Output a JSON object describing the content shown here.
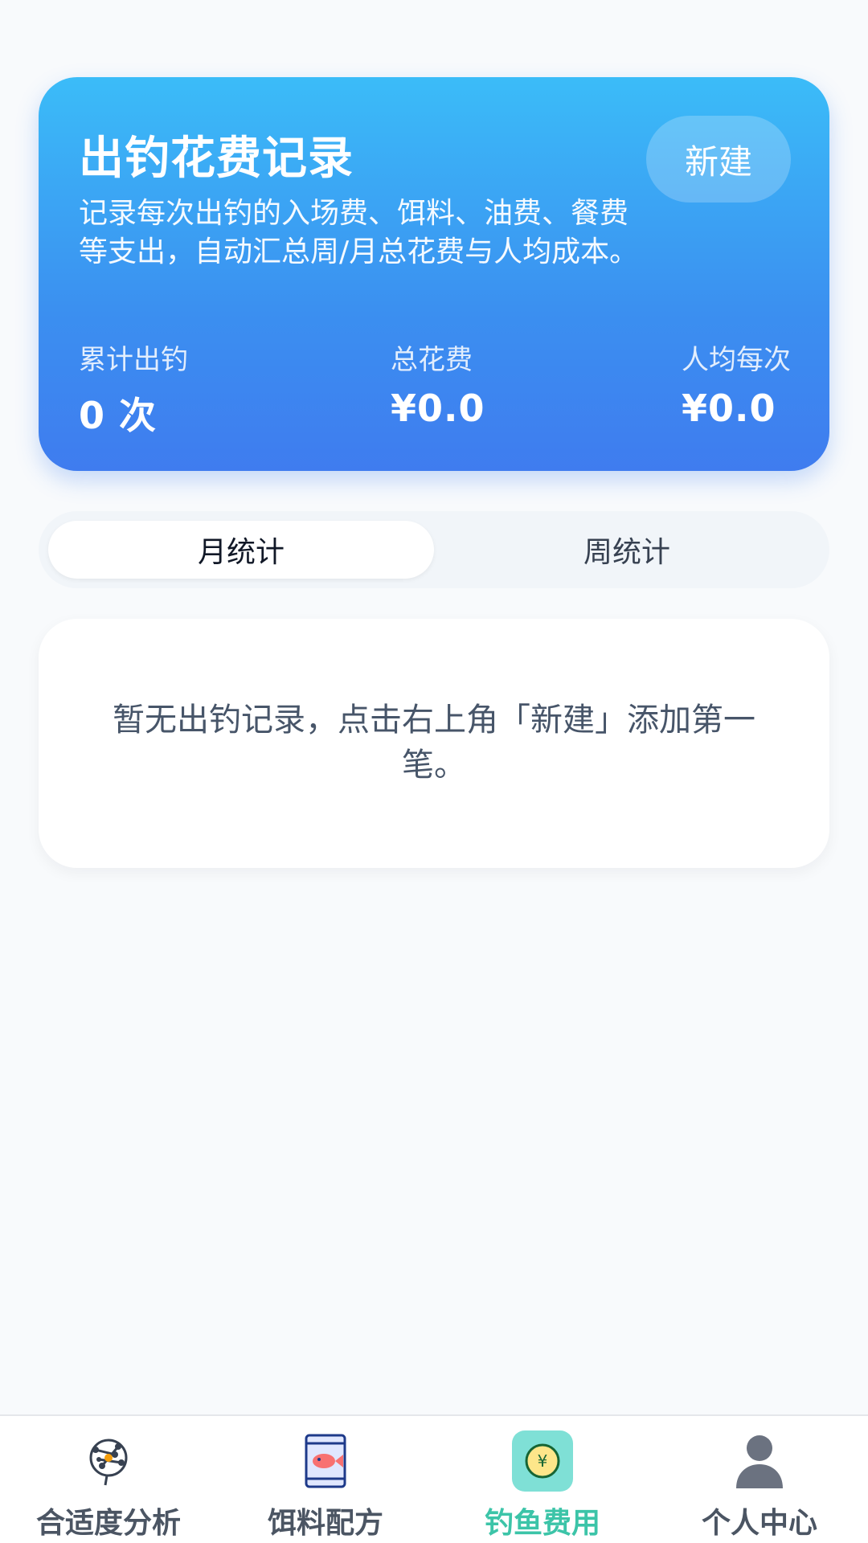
{
  "hero": {
    "title": "出钓花费记录",
    "description": "记录每次出钓的入场费、饵料、油费、餐费等支出，自动汇总周/月总花费与人均成本。",
    "new_button": "新建",
    "stats": [
      {
        "label": "累计出钓",
        "value": "0 次"
      },
      {
        "label": "总花费",
        "value": "¥0.0"
      },
      {
        "label": "人均每次",
        "value": "¥0.0"
      }
    ]
  },
  "tabs": [
    {
      "label": "月统计",
      "active": true
    },
    {
      "label": "周统计",
      "active": false
    }
  ],
  "empty": {
    "message": "暂无出钓记录，点击右上角「新建」添加第一笔。"
  },
  "bottom_nav": [
    {
      "label": "合适度分析",
      "icon": "network-brain-icon"
    },
    {
      "label": "饵料配方",
      "icon": "fish-bait-bag-icon"
    },
    {
      "label": "钓鱼费用",
      "icon": "yen-coin-icon",
      "active": true
    },
    {
      "label": "个人中心",
      "icon": "user-avatar-icon"
    }
  ],
  "colors": {
    "hero_gradient_top": "#3bbcf8",
    "hero_gradient_bottom": "#3f7cef",
    "active_nav": "#3cc4a8",
    "active_icon_bg": "#7fe0d6"
  }
}
